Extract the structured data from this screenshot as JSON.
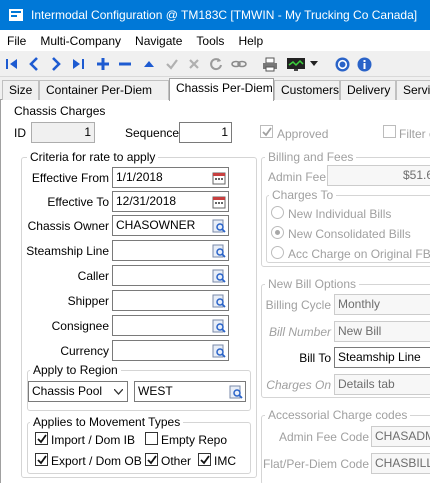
{
  "window": {
    "title": "Intermodal Configuration @ TM183C [TMWIN - My Trucking Co Canada]"
  },
  "menu": [
    "File",
    "Multi-Company",
    "Navigate",
    "Tools",
    "Help"
  ],
  "toolbar": {
    "icons": [
      "first-record-icon",
      "prev-record-icon",
      "next-record-icon",
      "last-record-icon",
      "add-icon",
      "remove-icon",
      "move-up-icon",
      "save-check-icon",
      "cancel-x-icon",
      "refresh-icon",
      "link-icon",
      "print-icon",
      "monitor-icon",
      "dropdown-arrow-icon",
      "help-icon",
      "info-icon"
    ]
  },
  "tabs": [
    "Size",
    "Container Per-Diem",
    "Chassis Per-Diem",
    "Customers",
    "Delivery",
    "Servic"
  ],
  "chassis_charges": {
    "title": "Chassis Charges",
    "id_label": "ID",
    "id_value": "1",
    "sequence_label": "Sequence",
    "sequence_value": "1",
    "approved_label": "Approved",
    "filter_label": "Filter c"
  },
  "criteria": {
    "title": "Criteria for rate to apply",
    "effective_from_label": "Effective From",
    "effective_from": "1/1/2018",
    "effective_to_label": "Effective To",
    "effective_to": "12/31/2018",
    "chassis_owner_label": "Chassis Owner",
    "chassis_owner": "CHASOWNER",
    "steamship_label": "Steamship Line",
    "caller_label": "Caller",
    "shipper_label": "Shipper",
    "consignee_label": "Consignee",
    "currency_label": "Currency"
  },
  "region": {
    "title": "Apply to Region",
    "type": "Chassis Pool",
    "value": "WEST"
  },
  "movement": {
    "title": "Applies to Movement Types",
    "import": "Import / Dom IB",
    "empty": "Empty Repo",
    "export": "Export / Dom OB",
    "other": "Other",
    "imc": "IMC"
  },
  "billing": {
    "title": "Billing and Fees",
    "admin_fee_label": "Admin Fee",
    "admin_fee": "$51.6",
    "charges_to_title": "Charges To",
    "opt1": "New Individual Bills",
    "opt2": "New Consolidated Bills",
    "opt3": "Acc Charge on Original FB"
  },
  "new_bill": {
    "title": "New Bill Options",
    "cycle_label": "Billing Cycle",
    "cycle": "Monthly",
    "number_label": "Bill Number",
    "number": "New Bill",
    "bill_to_label": "Bill To",
    "bill_to": "Steamship Line",
    "charges_on_label": "Charges On",
    "charges_on": "Details tab"
  },
  "accessorial": {
    "title": "Accessorial Charge codes",
    "admin_code_label": "Admin Fee Code",
    "admin_code": "CHASADM",
    "flat_code_label": "Flat/Per-Diem Code",
    "flat_code": "CHASBILL"
  }
}
